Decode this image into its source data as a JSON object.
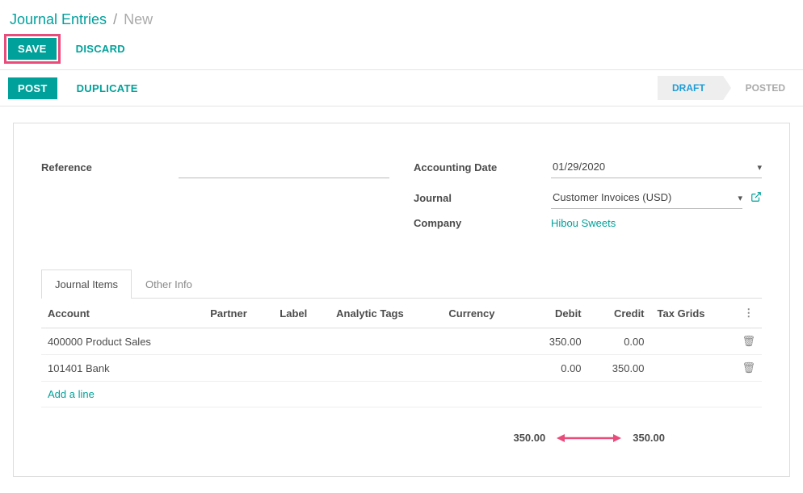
{
  "breadcrumb": {
    "root": "Journal Entries",
    "current": "New",
    "sep": "/"
  },
  "actions": {
    "save": "SAVE",
    "discard": "DISCARD",
    "post": "POST",
    "duplicate": "DUPLICATE"
  },
  "status": {
    "draft": "DRAFT",
    "posted": "POSTED"
  },
  "fields": {
    "reference_label": "Reference",
    "reference_value": "",
    "accounting_date_label": "Accounting Date",
    "accounting_date_value": "01/29/2020",
    "journal_label": "Journal",
    "journal_value": "Customer Invoices (USD)",
    "company_label": "Company",
    "company_value": "Hibou Sweets"
  },
  "tabs": {
    "items": [
      "Journal Items",
      "Other Info"
    ]
  },
  "grid": {
    "headers": {
      "account": "Account",
      "partner": "Partner",
      "label": "Label",
      "analytic": "Analytic Tags",
      "currency": "Currency",
      "debit": "Debit",
      "credit": "Credit",
      "tax": "Tax Grids"
    },
    "rows": [
      {
        "account": "400000 Product Sales",
        "partner": "",
        "label": "",
        "analytic": "",
        "currency": "",
        "debit": "350.00",
        "credit": "0.00",
        "tax": ""
      },
      {
        "account": "101401 Bank",
        "partner": "",
        "label": "",
        "analytic": "",
        "currency": "",
        "debit": "0.00",
        "credit": "350.00",
        "tax": ""
      }
    ],
    "add_line": "Add a line"
  },
  "totals": {
    "debit": "350.00",
    "credit": "350.00"
  }
}
